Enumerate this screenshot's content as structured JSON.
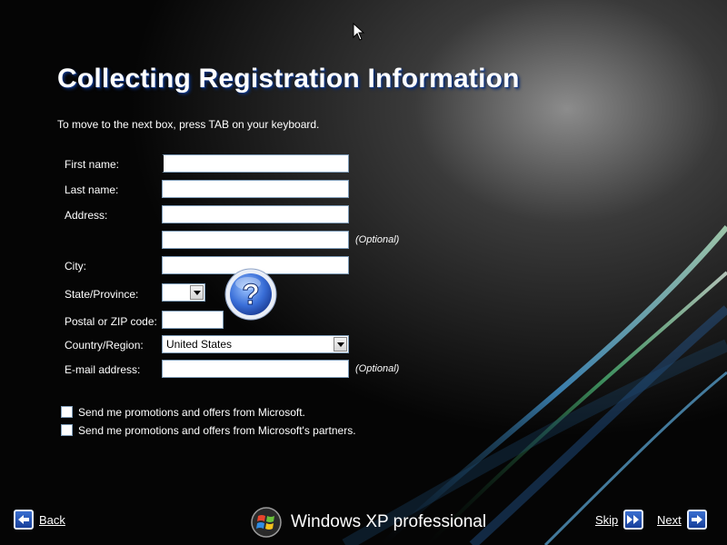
{
  "page": {
    "title": "Collecting Registration Information",
    "instructions": "To move to the next box, press TAB on your keyboard."
  },
  "form": {
    "first_name": {
      "label": "First name:",
      "value": ""
    },
    "last_name": {
      "label": "Last name:",
      "value": ""
    },
    "address": {
      "label": "Address:",
      "value": ""
    },
    "address2": {
      "value": "",
      "note": "(Optional)"
    },
    "city": {
      "label": "City:",
      "value": ""
    },
    "state": {
      "label": "State/Province:",
      "value": ""
    },
    "postal": {
      "label": "Postal or ZIP code:",
      "value": ""
    },
    "country": {
      "label": "Country/Region:",
      "value": "United States"
    },
    "email": {
      "label": "E-mail address:",
      "value": "",
      "note": "(Optional)"
    }
  },
  "checkboxes": [
    {
      "label": "Send me promotions and offers from Microsoft.",
      "checked": false
    },
    {
      "label": "Send me promotions and offers from Microsoft's partners.",
      "checked": false
    }
  ],
  "nav": {
    "back": "Back",
    "skip": "Skip",
    "next": "Next"
  },
  "branding": {
    "product": "Windows XP professional"
  },
  "icons": {
    "help": "question-mark-icon",
    "back": "arrow-left-icon",
    "skip": "double-arrow-right-icon",
    "next": "arrow-right-icon",
    "logo": "windows-logo-icon",
    "cursor": "mouse-pointer-icon"
  },
  "colors": {
    "title_shadow": "#1f4fb0",
    "accent_blue": "#173f9a"
  }
}
